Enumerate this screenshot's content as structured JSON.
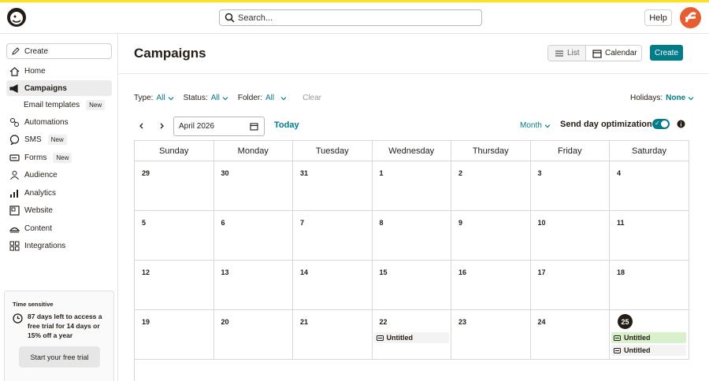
{
  "header": {
    "search_placeholder": "Search...",
    "help_label": "Help"
  },
  "sidebar": {
    "create_label": "Create",
    "items": [
      {
        "label": "Home",
        "icon": "home-icon"
      },
      {
        "label": "Campaigns",
        "icon": "megaphone-icon",
        "active": true
      },
      {
        "label": "Automations",
        "icon": "automation-icon"
      },
      {
        "label": "SMS",
        "icon": "sms-icon",
        "badge": "New"
      },
      {
        "label": "Forms",
        "icon": "forms-icon",
        "badge": "New"
      },
      {
        "label": "Audience",
        "icon": "audience-icon"
      },
      {
        "label": "Analytics",
        "icon": "analytics-icon"
      },
      {
        "label": "Website",
        "icon": "website-icon"
      },
      {
        "label": "Content",
        "icon": "content-icon"
      },
      {
        "label": "Integrations",
        "icon": "integrations-icon"
      }
    ],
    "sub_item": {
      "label": "Email templates",
      "badge": "New"
    },
    "promo": {
      "tag": "Time sensitive",
      "message": "87 days left to access a free trial for 14 days or 15% off a year",
      "button": "Start your free trial"
    }
  },
  "main": {
    "title": "Campaigns",
    "view_list": "List",
    "view_calendar": "Calendar",
    "create_label": "Create",
    "filters": {
      "type_label": "Type:",
      "type_value": "All",
      "status_label": "Status:",
      "status_value": "All",
      "folder_label": "Folder:",
      "folder_value": "All",
      "clear": "Clear"
    },
    "holidays_label": "Holidays:",
    "holidays_value": "None",
    "date_value": "April 2026",
    "today_label": "Today",
    "month_label": "Month",
    "send_day_label": "Send day optimization:",
    "accent_color": "#007c89"
  },
  "calendar": {
    "days": [
      "Sunday",
      "Monday",
      "Tuesday",
      "Wednesday",
      "Thursday",
      "Friday",
      "Saturday"
    ],
    "weeks": [
      [
        "29",
        "30",
        "31",
        "1",
        "2",
        "3",
        "4"
      ],
      [
        "5",
        "6",
        "7",
        "8",
        "9",
        "10",
        "11"
      ],
      [
        "12",
        "13",
        "14",
        "15",
        "16",
        "17",
        "18"
      ],
      [
        "19",
        "20",
        "21",
        "22",
        "23",
        "24",
        "25"
      ]
    ],
    "today": "25",
    "events": [
      {
        "week": 3,
        "day": 3,
        "label": "Untitled",
        "style": "grey"
      },
      {
        "week": 3,
        "day": 6,
        "label": "Untitled",
        "style": "green"
      },
      {
        "week": 3,
        "day": 6,
        "label": "Untitled",
        "style": "grey"
      }
    ]
  }
}
